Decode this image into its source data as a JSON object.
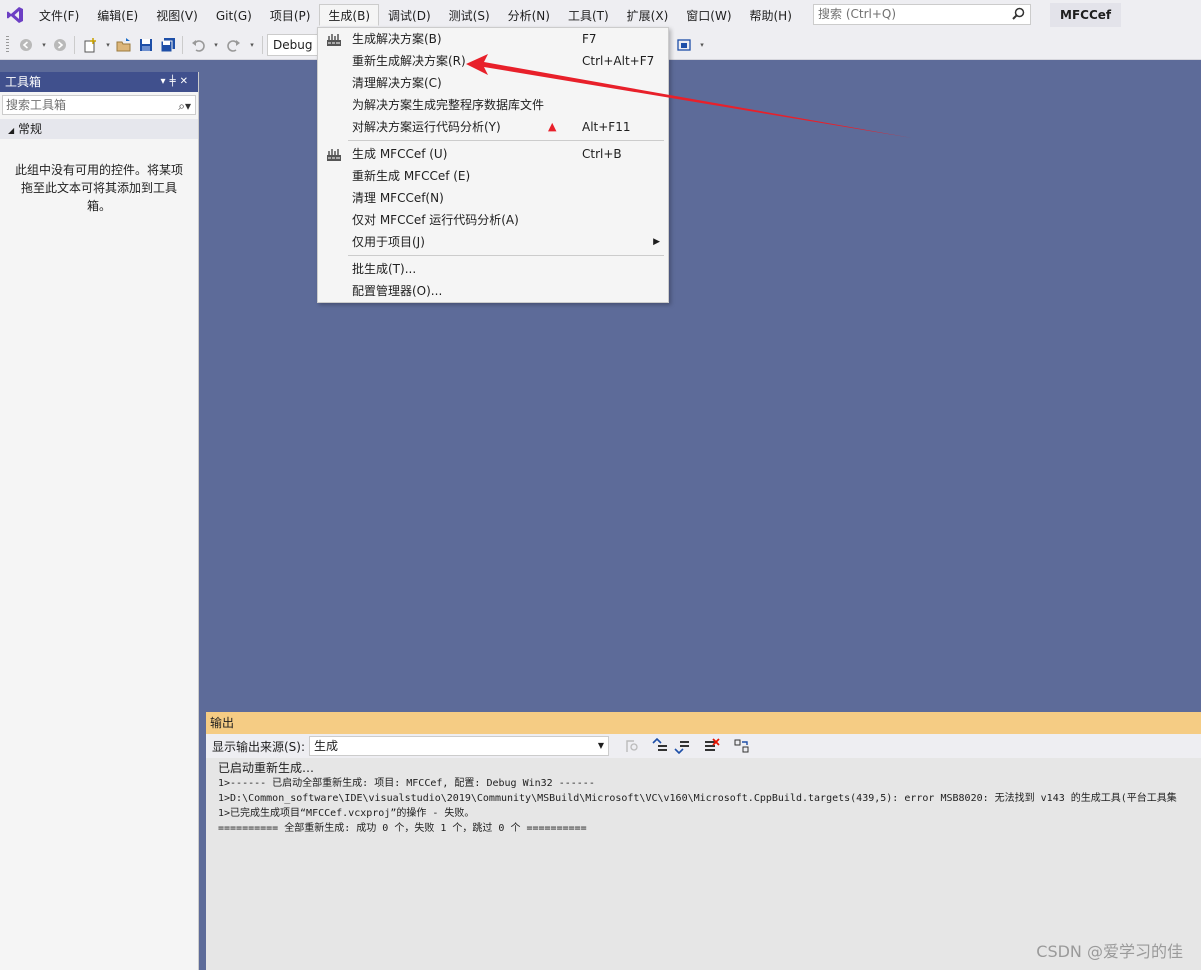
{
  "menubar": {
    "items": [
      {
        "label": "文件(F)"
      },
      {
        "label": "编辑(E)"
      },
      {
        "label": "视图(V)"
      },
      {
        "label": "Git(G)"
      },
      {
        "label": "项目(P)"
      },
      {
        "label": "生成(B)"
      },
      {
        "label": "调试(D)"
      },
      {
        "label": "测试(S)"
      },
      {
        "label": "分析(N)"
      },
      {
        "label": "工具(T)"
      },
      {
        "label": "扩展(X)"
      },
      {
        "label": "窗口(W)"
      },
      {
        "label": "帮助(H)"
      }
    ],
    "search_placeholder": "搜索 (Ctrl+Q)",
    "solution_name": "MFCCef"
  },
  "toolbar": {
    "config": "Debug"
  },
  "toolbox": {
    "title": "工具箱",
    "search_placeholder": "搜索工具箱",
    "group": "常规",
    "empty_message": "此组中没有可用的控件。将某项拖至此文本可将其添加到工具箱。"
  },
  "build_menu": {
    "items": [
      {
        "label": "生成解决方案(B)",
        "shortcut": "F7",
        "icon": "build-icon"
      },
      {
        "label": "重新生成解决方案(R)",
        "shortcut": "Ctrl+Alt+F7"
      },
      {
        "label": "清理解决方案(C)",
        "shortcut": ""
      },
      {
        "label": "为解决方案生成完整程序数据库文件",
        "shortcut": ""
      },
      {
        "label": "对解决方案运行代码分析(Y)",
        "shortcut": "Alt+F11",
        "warning": "▲"
      },
      {
        "label": "生成 MFCCef (U)",
        "shortcut": "Ctrl+B",
        "icon": "build-icon"
      },
      {
        "label": "重新生成 MFCCef (E)",
        "shortcut": ""
      },
      {
        "label": "清理 MFCCef(N)",
        "shortcut": ""
      },
      {
        "label": "仅对 MFCCef 运行代码分析(A)",
        "shortcut": ""
      },
      {
        "label": "仅用于项目(J)",
        "shortcut": "",
        "submenu": true
      },
      {
        "label": "批生成(T)...",
        "shortcut": ""
      },
      {
        "label": "配置管理器(O)...",
        "shortcut": ""
      }
    ]
  },
  "output": {
    "title": "输出",
    "source_label": "显示输出来源(S):",
    "source_value": "生成",
    "lines": [
      "已启动重新生成…",
      "1>------ 已启动全部重新生成: 项目: MFCCef, 配置: Debug Win32 ------",
      "1>D:\\Common_software\\IDE\\visualstudio\\2019\\Community\\MSBuild\\Microsoft\\VC\\v160\\Microsoft.CppBuild.targets(439,5): error MSB8020: 无法找到 v143 的生成工具(平台工具集",
      "1>已完成生成项目“MFCCef.vcxproj”的操作 - 失败。",
      "========== 全部重新生成: 成功 0 个，失败 1 个，跳过 0 个 =========="
    ]
  },
  "watermark": "CSDN @爱学习的佳",
  "colors": {
    "accent": "#40508d",
    "background": "#5d6b99",
    "output_header": "#f5cc84",
    "annotation_arrow": "#e8202a"
  }
}
